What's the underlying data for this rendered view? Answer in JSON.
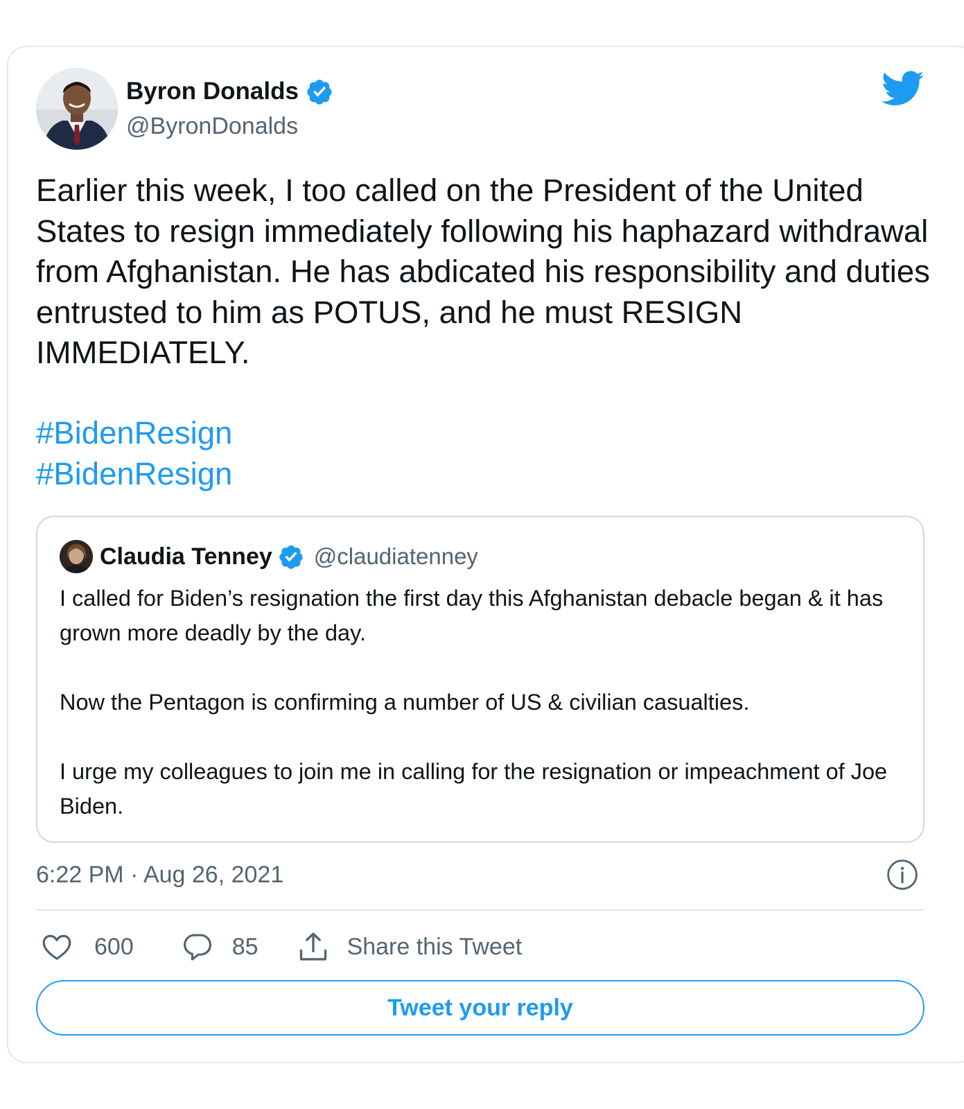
{
  "tweet": {
    "author_name": "Byron Donalds",
    "author_handle": "@ByronDonalds",
    "text": "Earlier this week, I too called on the President of the United States to resign immediately following his haphazard withdrawal from Afghanistan. He has abdicated his responsibility and duties entrusted to him as POTUS, and he must RESIGN IMMEDIATELY.",
    "hashtags": [
      "#BidenResign",
      "#BidenResign"
    ],
    "timestamp": "6:22 PM · Aug 26, 2021",
    "likes": "600",
    "replies": "85",
    "share_label": "Share this Tweet",
    "reply_button_label": "Tweet your reply"
  },
  "quote": {
    "author_name": "Claudia Tenney",
    "author_handle": "@claudiatenney",
    "paragraphs": [
      "I called for Biden’s resignation the first day this Afghanistan debacle began & it has grown more deadly by the day.",
      "Now the Pentagon is confirming a number of US & civilian casualties.",
      "I urge my colleagues to join me in calling for the resignation or impeachment of Joe Biden."
    ]
  },
  "icons": {
    "brand": "twitter-bird-icon",
    "verified": "verified-badge-icon",
    "info": "info-icon",
    "like": "heart-icon",
    "reply": "speech-bubble-icon",
    "share": "share-upload-icon"
  },
  "colors": {
    "accent": "#1d9bf0",
    "verified": "#1d9bf0",
    "text_primary": "#0f1419",
    "text_secondary": "#536471",
    "border": "#e1e8ed"
  }
}
